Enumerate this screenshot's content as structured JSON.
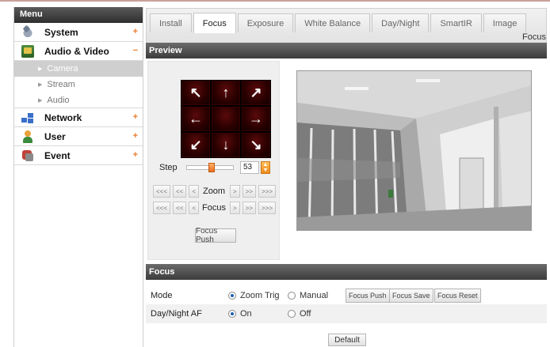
{
  "sidebar": {
    "header": "Menu",
    "items": [
      {
        "label": "System",
        "icon": "system-icon",
        "expander": "+"
      },
      {
        "label": "Audio & Video",
        "icon": "audio-video-icon",
        "expander": "−"
      },
      {
        "label": "Network",
        "icon": "network-icon",
        "expander": "+"
      },
      {
        "label": "User",
        "icon": "user-icon",
        "expander": "+"
      },
      {
        "label": "Event",
        "icon": "event-icon",
        "expander": "+"
      }
    ],
    "subitems": [
      {
        "label": "Camera",
        "active": true
      },
      {
        "label": "Stream",
        "active": false
      },
      {
        "label": "Audio",
        "active": false
      }
    ]
  },
  "tabs": [
    "Install",
    "Focus",
    "Exposure",
    "White Balance",
    "Day/Night",
    "SmartIR",
    "Image"
  ],
  "active_tab": "Focus",
  "page_title": "Focus",
  "preview": {
    "header": "Preview",
    "step_label": "Step",
    "step_value": "53",
    "step_fraction": 0.53,
    "zoom_label": "Zoom",
    "focus_label": "Focus",
    "nav_buttons": [
      "<<<",
      "<<",
      "<",
      ">",
      ">>",
      ">>>"
    ],
    "focus_push_label": "Focus Push"
  },
  "focus_settings": {
    "header": "Focus",
    "mode_label": "Mode",
    "mode_options": [
      "Zoom Trig",
      "Manual"
    ],
    "mode_selected": "Zoom Trig",
    "buttons": [
      "Focus Push",
      "Focus Save",
      "Focus Reset"
    ],
    "daynight_label": "Day/Night AF",
    "daynight_options": [
      "On",
      "Off"
    ],
    "daynight_selected": "On"
  },
  "default_button": "Default",
  "colors": {
    "accent_orange": "#e87a2a",
    "section_header": "#4a4a4a",
    "ptz_red": "#5a0a0a",
    "radio_blue": "#1d5fb0"
  }
}
